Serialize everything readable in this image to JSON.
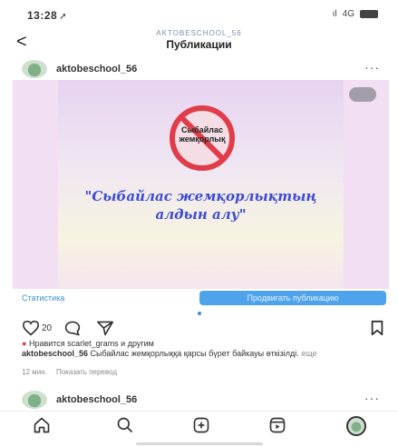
{
  "status": {
    "time": "13:28",
    "signal": "4G"
  },
  "header": {
    "account": "AKTOBESCHOOL_56",
    "title": "Публикации"
  },
  "post": {
    "username": "aktobeschool_56",
    "image": {
      "sign_text_1": "Сыбайлас",
      "sign_text_2": "жемқорлық",
      "slogan": "\"Сыбайлас жемқорлықтың алдын алу\""
    },
    "stats_link": "Статистика",
    "promote_button": "Продвигать публикацию",
    "likes_count": "20",
    "liked_by": "Нравится scarlet_grams и другим",
    "caption_user": "aktobeschool_56",
    "caption_text": "Сыбайлас жемқорлыққа қарсы бүрет байкауы өткізілді.",
    "caption_more": "еще",
    "time_ago": "12 мин.",
    "translate": "Показать перевод"
  },
  "post2": {
    "username": "aktobeschool_56"
  },
  "colors": {
    "accent": "#3a8fd9",
    "slogan": "#3d4bd3",
    "sign_red": "#e03c4a"
  }
}
